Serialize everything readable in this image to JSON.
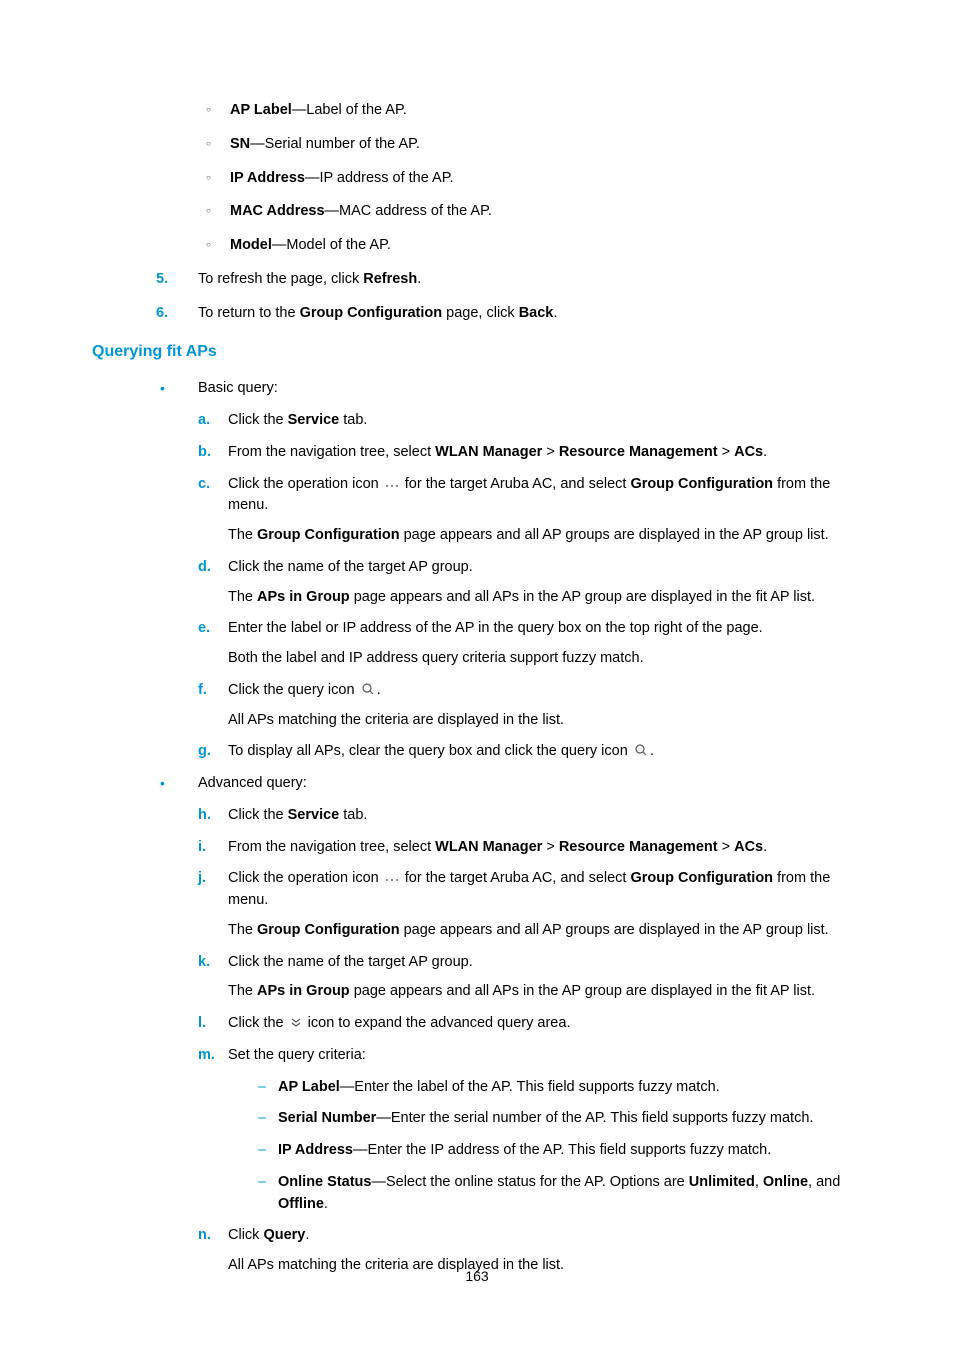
{
  "circ": [
    {
      "term": "AP Label",
      "desc": "—Label of the AP."
    },
    {
      "term": "SN",
      "desc": "—Serial number of the AP."
    },
    {
      "term": "IP Address",
      "desc": "—IP address of the AP."
    },
    {
      "term": "MAC Address",
      "desc": "—MAC address of the AP."
    },
    {
      "term": "Model",
      "desc": "—Model of the AP."
    }
  ],
  "num5": {
    "m": "5.",
    "pre": "To refresh the page, click ",
    "b": "Refresh",
    "post": "."
  },
  "num6": {
    "m": "6.",
    "pre": "To return to the ",
    "b1": "Group Configuration",
    "mid": " page, click ",
    "b2": "Back",
    "post": "."
  },
  "heading": "Querying fit APs",
  "basic_label": "Basic query:",
  "adv_label": "Advanced query:",
  "steps": {
    "a": {
      "m": "a.",
      "pre": "Click the ",
      "b": "Service",
      "post": " tab."
    },
    "b": {
      "m": "b.",
      "pre": "From the navigation tree, select ",
      "b1": "WLAN Manager",
      "sep": " > ",
      "b2": "Resource Management",
      "b3": "ACs",
      "post": "."
    },
    "c": {
      "m": "c.",
      "pre": "Click the operation icon ",
      "mid": " for the target Aruba AC, and select ",
      "b": "Group Configuration",
      "post": " from the menu."
    },
    "c_p1": "The ",
    "c_pb": "Group Configuration",
    "c_p2": " page appears and all AP groups are displayed in the AP group list.",
    "d": {
      "m": "d.",
      "t": "Click the name of the target AP group."
    },
    "d_p1": "The ",
    "d_pb": "APs in Group",
    "d_p2": " page appears and all APs in the AP group are displayed in the fit AP list.",
    "e": {
      "m": "e.",
      "t": "Enter the label or IP address of the AP in the query box on the top right of the page."
    },
    "e_p": "Both the label and IP address query criteria support fuzzy match.",
    "f": {
      "m": "f.",
      "pre": "Click the query icon ",
      "post": "."
    },
    "f_p": "All APs matching the criteria are displayed in the list.",
    "g": {
      "m": "g.",
      "pre": "To display all APs, clear the query box and click the query icon ",
      "post": "."
    },
    "h": {
      "m": "h.",
      "pre": "Click the ",
      "b": "Service",
      "post": " tab."
    },
    "i": {
      "m": "i.",
      "pre": "From the navigation tree, select ",
      "b1": "WLAN Manager",
      "sep": " > ",
      "b2": "Resource Management",
      "b3": "ACs",
      "post": "."
    },
    "j": {
      "m": "j.",
      "pre": "Click the operation icon ",
      "mid": " for the target Aruba AC, and select ",
      "b": "Group Configuration",
      "post": " from the menu."
    },
    "j_p1": "The ",
    "j_pb": "Group Configuration",
    "j_p2": " page appears and all AP groups are displayed in the AP group list.",
    "k": {
      "m": "k.",
      "t": "Click the name of the target AP group."
    },
    "k_p1": "The ",
    "k_pb": "APs in Group",
    "k_p2": " page appears and all APs in the AP group are displayed in the fit AP list.",
    "l": {
      "m": "l.",
      "pre": "Click the ",
      "post": " icon to expand the advanced query area."
    },
    "m": {
      "m": "m.",
      "t": "Set the query criteria:"
    },
    "n": {
      "m": "n.",
      "pre": "Click ",
      "b": "Query",
      "post": "."
    },
    "n_p": "All APs matching the criteria are displayed in the list."
  },
  "criteria": [
    {
      "b": "AP Label",
      "t": "—Enter the label of the AP. This field supports fuzzy match."
    },
    {
      "b": "Serial Number",
      "t": "—Enter the serial number of the AP. This field supports fuzzy match."
    },
    {
      "b": "IP Address",
      "t": "—Enter the IP address of the AP. This field supports fuzzy match."
    }
  ],
  "criteria_os": {
    "b": "Online Status",
    "pre": "—Select the online status for the AP. Options are ",
    "o1": "Unlimited",
    "sep": ", ",
    "o2": "Online",
    "and": ", and ",
    "o3": "Offline",
    "post": "."
  },
  "pagenum": "163"
}
